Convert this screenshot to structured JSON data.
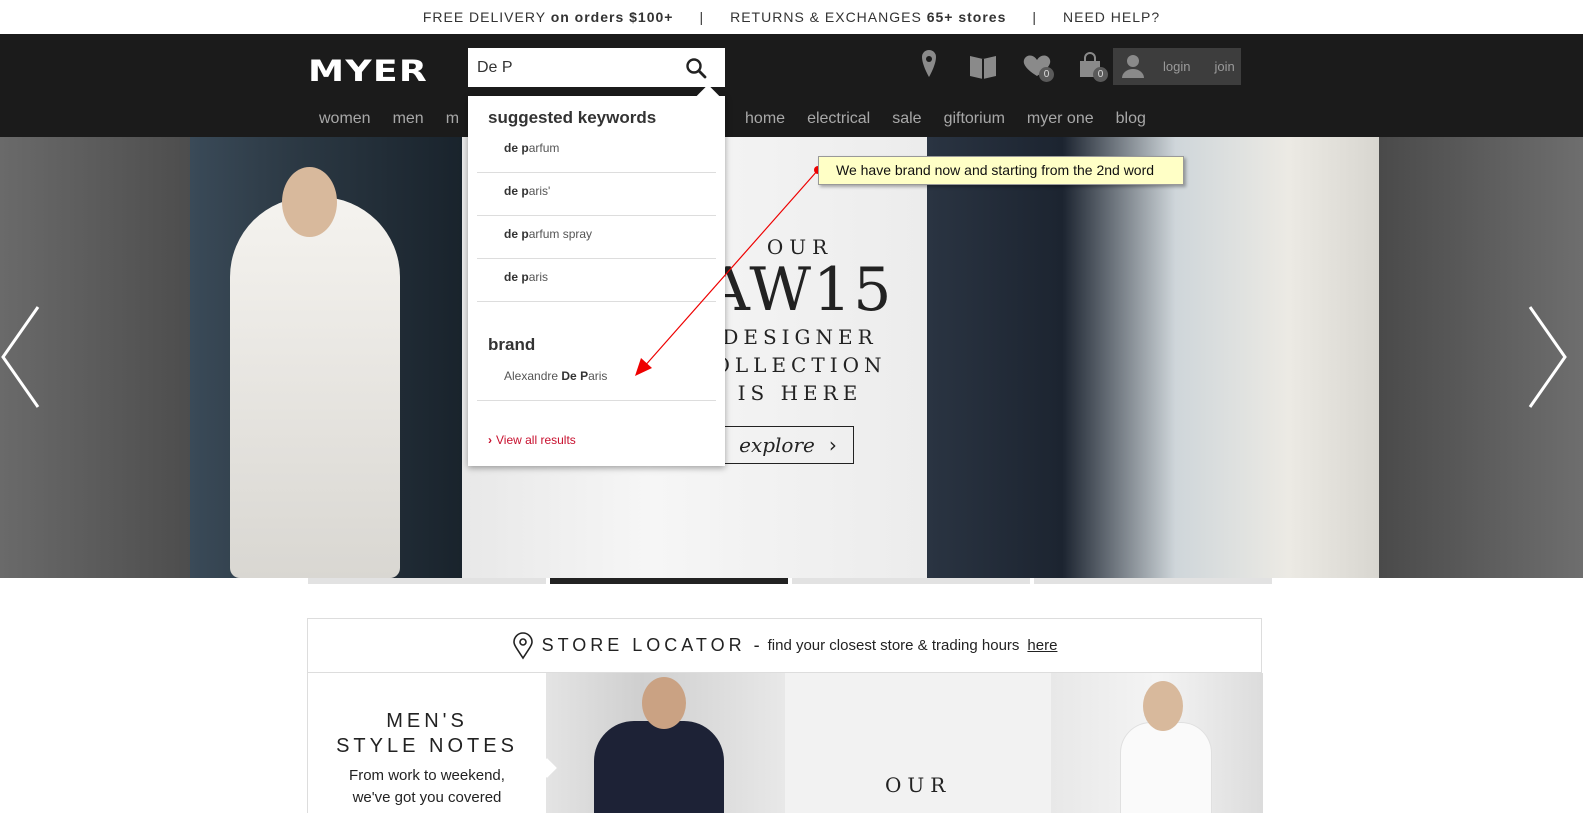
{
  "topbar": {
    "free_delivery": "FREE DELIVERY",
    "free_delivery_sub": "on orders $100+",
    "separator": "|",
    "returns": "RETURNS & EXCHANGES",
    "returns_sub": "65+ stores",
    "help": "NEED HELP?"
  },
  "header": {
    "logo": "MYER",
    "search_value": "De P",
    "wishlist_count": "0",
    "bag_count": "0",
    "login": "login",
    "join": "join"
  },
  "nav": [
    "women",
    "men",
    "m",
    "home",
    "electrical",
    "sale",
    "giftorium",
    "myer one",
    "blog"
  ],
  "dropdown": {
    "suggested_heading": "suggested keywords",
    "suggestions": [
      {
        "bold1": "de",
        "sp": " ",
        "bold2": "p",
        "rest": "arfum"
      },
      {
        "bold1": "de",
        "sp": " ",
        "bold2": "p",
        "rest": "aris'"
      },
      {
        "bold1": "de",
        "sp": " ",
        "bold2": "p",
        "rest": "arfum spray"
      },
      {
        "bold1": "de",
        "sp": " ",
        "bold2": "p",
        "rest": "aris"
      }
    ],
    "brand_heading": "brand",
    "brand": {
      "pre": "Alexandre ",
      "bold1": "De",
      "sp": " ",
      "bold2": "P",
      "rest": "aris"
    },
    "view_all_arrow": "›",
    "view_all": "View all results"
  },
  "hero": {
    "our": "OUR",
    "aw": "AW15",
    "line1": "DESIGNER",
    "line2": "OLLECTION",
    "line3": "IS HERE",
    "explore": "explore",
    "explore_arrow": "›"
  },
  "annotation": {
    "text": "We have brand now and starting from the 2nd word"
  },
  "store": {
    "title": "STORE LOCATOR",
    "dash": "-",
    "sub": "find your closest store & trading hours",
    "link": "here"
  },
  "tiles": {
    "mens_title_1": "MEN'S",
    "mens_title_2": "STYLE NOTES",
    "mens_text_1": "From work to weekend,",
    "mens_text_2": "we've got you covered",
    "our": "OUR"
  },
  "colors": {
    "header_bg": "#1b1b1b",
    "accent_red": "#c8102e",
    "tooltip_bg": "#ffffc6"
  }
}
